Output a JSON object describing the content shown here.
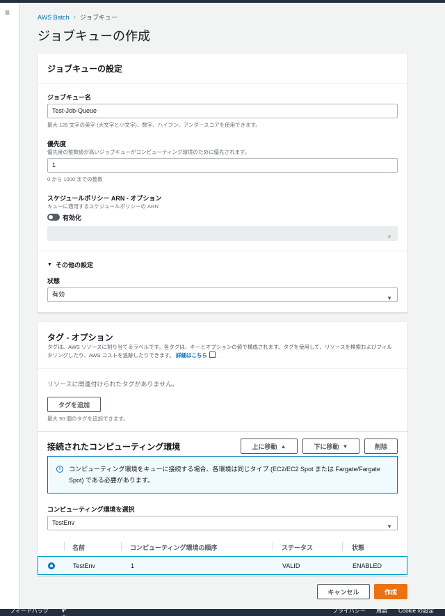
{
  "nav": {
    "menu_icon": "≡"
  },
  "breadcrumb": {
    "root": "AWS Batch",
    "current": "ジョブキュー"
  },
  "page_title": "ジョブキューの作成",
  "settings": {
    "header": "ジョブキューの設定",
    "name_label": "ジョブキュー名",
    "name_value": "Test-Job-Queue",
    "name_hint": "最大 128 文字の英字 (大文字と小文字)、数字、ハイフン、アンダースコアを使用できます。",
    "priority_label": "優先度",
    "priority_desc": "優先度の整数値が高いジョブキューがコンピューティング環境のために優先されます。",
    "priority_value": "1",
    "priority_hint": "0 から 1000 までの整数",
    "schedule_label": "スケジュールポリシー ARN - オプション",
    "schedule_desc": "キューに適用するスケジュールポリシーの ARN",
    "enable_label": "有効化",
    "other_settings": "その他の設定",
    "state_label": "状態",
    "state_value": "有効"
  },
  "tags": {
    "header": "タグ - オプション",
    "desc": "タグは、AWS リソースに割り当てるラベルです。各タグは、キーとオプションの値で構成されます。タグを使用して、リソースを検索およびフィルタリングしたり、AWS コストを追跡したりできます。",
    "learn_more": "詳細はこちら",
    "empty": "リソースに関連付けられたタグがありません。",
    "add_button": "タグを追加",
    "add_hint": "最大 50 個のタグを追加できます。"
  },
  "compute": {
    "header": "接続されたコンピューティング環境",
    "move_up": "上に移動",
    "move_down": "下に移動",
    "delete": "削除",
    "info": "コンピューティング環境をキューに接続する場合、各環境は同じタイプ (EC2/EC2 Spot または Fargate/Fargate Spot) である必要があります。",
    "select_label": "コンピューティング環境を選択",
    "select_value": "TestEnv",
    "columns": [
      "名前",
      "コンピューティング環境の順序",
      "ステータス",
      "状態"
    ],
    "rows": [
      {
        "name": "TestEnv",
        "order": "1",
        "status": "VALID",
        "state": "ENABLED"
      }
    ]
  },
  "actions": {
    "cancel": "キャンセル",
    "create": "作成"
  },
  "footer": {
    "feedback": "フィードバック",
    "language": "日本語",
    "privacy": "プライバシー",
    "terms": "用語",
    "cookies": "Cookie の設定"
  }
}
